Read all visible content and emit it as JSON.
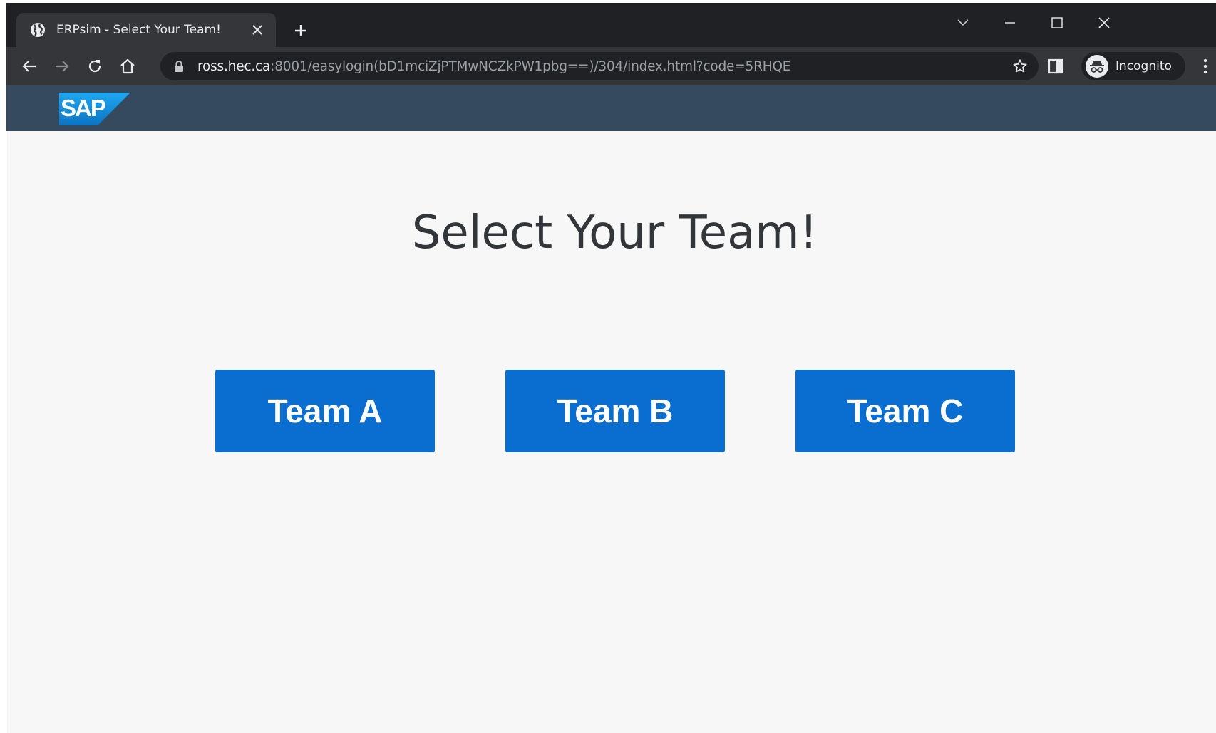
{
  "browser": {
    "tab": {
      "title": "ERPsim - Select Your Team!",
      "favicon": "globe-icon"
    },
    "address_bar": {
      "host": "ross.hec.ca",
      "rest": ":8001/easylogin(bD1mciZjPTMwNCZkPW1pbg==)/304/index.html?code=5RHQE"
    },
    "profile_label": "Incognito"
  },
  "app": {
    "header": {
      "logo_text": "SAP",
      "brand_color": "#354a5f",
      "logo_color": "#0a8ad4"
    },
    "title": "Select Your Team!",
    "teams": [
      {
        "label": "Team A"
      },
      {
        "label": "Team B"
      },
      {
        "label": "Team C"
      }
    ],
    "button_color": "#0a6ed1"
  }
}
